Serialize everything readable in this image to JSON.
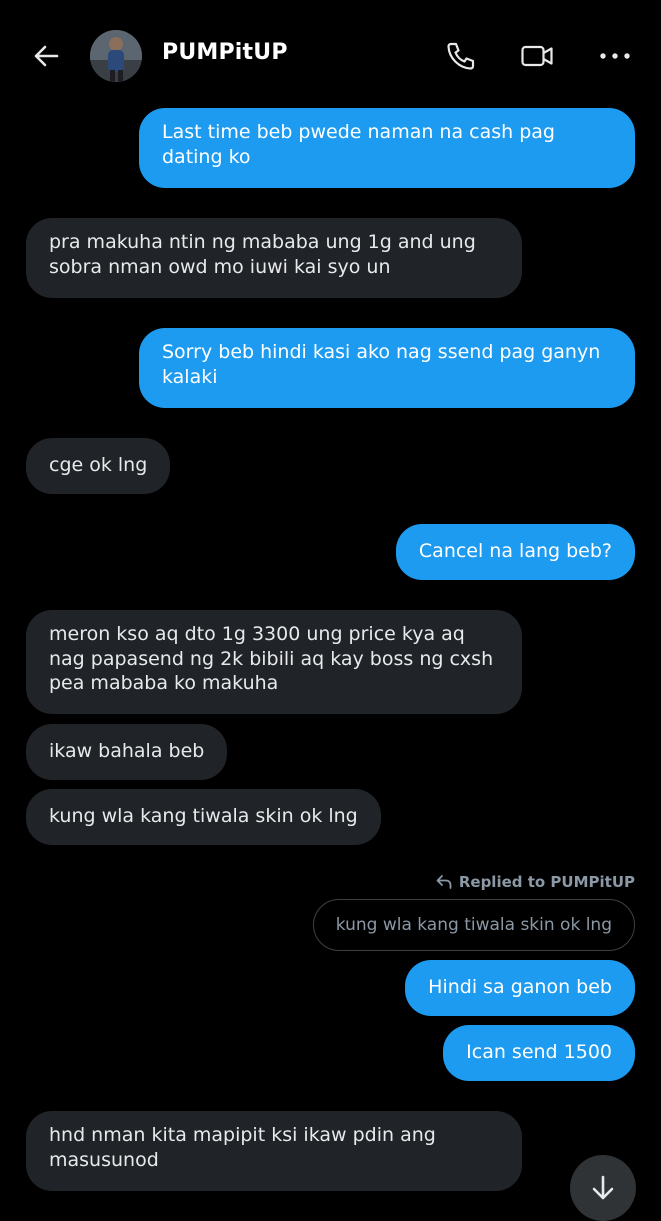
{
  "header": {
    "title": "PUMPitUP"
  },
  "icons": {
    "back": "arrow-left-icon",
    "call": "phone-icon",
    "video": "video-camera-icon",
    "more": "more-dots-icon",
    "reply": "reply-arrow-icon",
    "scroll_down": "arrow-down-icon"
  },
  "colors": {
    "outgoing_bubble": "#1d9bf0",
    "incoming_bubble": "#202327",
    "background": "#000000",
    "secondary_text": "#8b98a5"
  },
  "messages": [
    {
      "direction": "outgoing",
      "text": "Last time beb pwede naman na cash pag dating ko"
    },
    {
      "direction": "incoming",
      "text": "pra makuha ntin ng mababa ung 1g and ung sobra nman owd mo iuwi kai syo un"
    },
    {
      "direction": "outgoing",
      "text": "Sorry beb hindi kasi ako nag ssend pag ganyn kalaki"
    },
    {
      "direction": "incoming",
      "text": "cge ok lng"
    },
    {
      "direction": "outgoing",
      "text": "Cancel na lang beb?"
    },
    {
      "direction": "incoming",
      "text": "meron  kso aq dto 1g 3300 ung price kya aq nag papasend ng 2k bibili aq kay boss ng cxsh pea mababa ko makuha"
    },
    {
      "direction": "incoming",
      "text": "ikaw bahala beb"
    },
    {
      "direction": "incoming",
      "text": "kung wla kang tiwala skin ok lng"
    },
    {
      "direction": "outgoing",
      "text": "Hindi sa ganon beb"
    },
    {
      "direction": "outgoing",
      "text": "Ican send 1500"
    },
    {
      "direction": "incoming",
      "text": "hnd nman kita mapipit ksi ikaw pdin ang masusunod"
    }
  ],
  "reply": {
    "label": "Replied to PUMPitUP",
    "quoted_text": "kung wla kang tiwala skin ok lng"
  }
}
